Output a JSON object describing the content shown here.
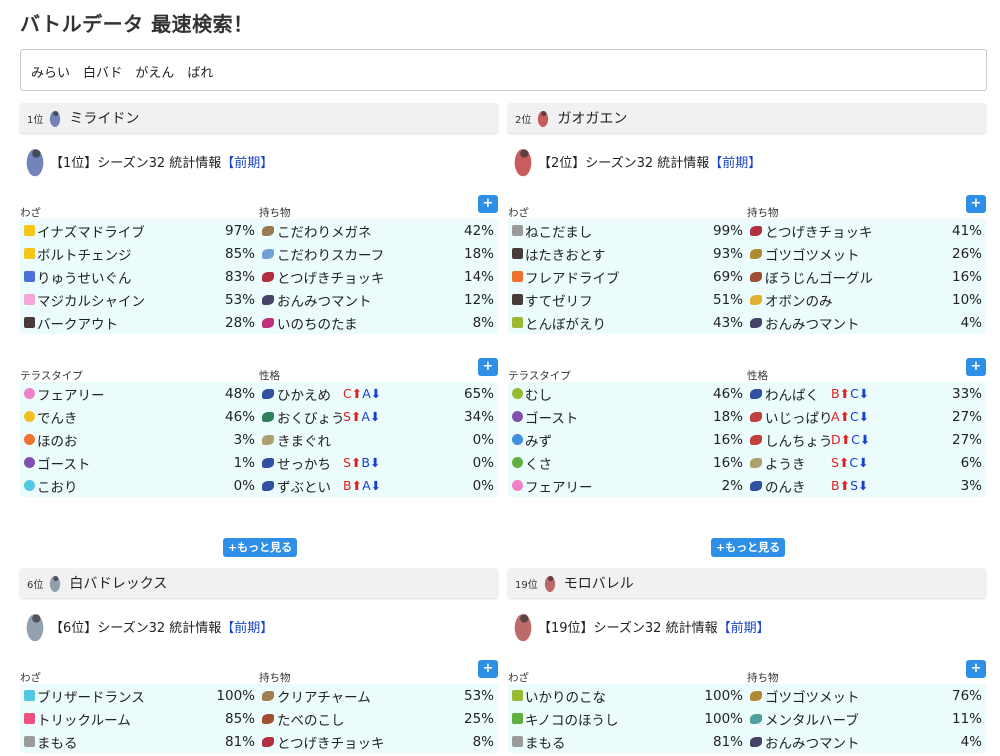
{
  "header": {
    "title": "バトルデータ 最速検索！",
    "search_value": "みらい　白バド　がえん　ばれ"
  },
  "labels": {
    "moves": "わざ",
    "items": "持ち物",
    "tera": "テラスタイプ",
    "nature": "性格",
    "plus": "+",
    "more": "+もっと見る",
    "stat_tag": "【前期】"
  },
  "colors": {
    "accent": "#2e8fe6",
    "row_bg": "#ecfbfb",
    "tag_blue": "#1a44c8",
    "up_red": "#e02020",
    "down_blue": "#1640d0"
  },
  "pokemon": [
    {
      "rank_label": "1位",
      "name": "ミライドン",
      "stat_title": "【1位】シーズン32 統計情報",
      "moves": [
        {
          "name": "イナズマドライブ",
          "pct": "97%",
          "color": "#f5c518"
        },
        {
          "name": "ボルトチェンジ",
          "pct": "85%",
          "color": "#f5c518"
        },
        {
          "name": "りゅうせいぐん",
          "pct": "83%",
          "color": "#4d6fd8"
        },
        {
          "name": "マジカルシャイン",
          "pct": "53%",
          "color": "#f5a6d8"
        },
        {
          "name": "バークアウト",
          "pct": "28%",
          "color": "#4a3b3b"
        }
      ],
      "items": [
        {
          "name": "こだわりメガネ",
          "pct": "42%",
          "color": "#9a7a50"
        },
        {
          "name": "こだわりスカーフ",
          "pct": "18%",
          "color": "#6fa0d8"
        },
        {
          "name": "とつげきチョッキ",
          "pct": "14%",
          "color": "#b03040"
        },
        {
          "name": "おんみつマント",
          "pct": "12%",
          "color": "#444466"
        },
        {
          "name": "いのちのたま",
          "pct": "8%",
          "color": "#c0307a"
        }
      ],
      "tera": [
        {
          "name": "フェアリー",
          "pct": "48%",
          "color": "#f080c8"
        },
        {
          "name": "でんき",
          "pct": "46%",
          "color": "#f0c020"
        },
        {
          "name": "ほのお",
          "pct": "3%",
          "color": "#f07030"
        },
        {
          "name": "ゴースト",
          "pct": "1%",
          "color": "#8050b0"
        },
        {
          "name": "こおり",
          "pct": "0%",
          "color": "#50c8e0"
        }
      ],
      "natures": [
        {
          "name": "ひかえめ",
          "up": "C",
          "down": "A",
          "pct": "65%",
          "color": "#3050a0"
        },
        {
          "name": "おくびょう",
          "up": "S",
          "down": "A",
          "pct": "34%",
          "color": "#308060"
        },
        {
          "name": "きまぐれ",
          "up": "",
          "down": "",
          "pct": "0%",
          "color": "#b0a070"
        },
        {
          "name": "せっかち",
          "up": "S",
          "down": "B",
          "pct": "0%",
          "color": "#3050a0"
        },
        {
          "name": "ずぶとい",
          "up": "B",
          "down": "A",
          "pct": "0%",
          "color": "#3050a0"
        }
      ]
    },
    {
      "rank_label": "2位",
      "name": "ガオガエン",
      "stat_title": "【2位】シーズン32 統計情報",
      "moves": [
        {
          "name": "ねこだまし",
          "pct": "99%",
          "color": "#9a9a9a"
        },
        {
          "name": "はたきおとす",
          "pct": "93%",
          "color": "#4a3b3b"
        },
        {
          "name": "フレアドライブ",
          "pct": "69%",
          "color": "#f07030"
        },
        {
          "name": "すてゼリフ",
          "pct": "51%",
          "color": "#4a3b3b"
        },
        {
          "name": "とんぼがえり",
          "pct": "43%",
          "color": "#9ab830"
        }
      ],
      "items": [
        {
          "name": "とつげきチョッキ",
          "pct": "41%",
          "color": "#b03040"
        },
        {
          "name": "ゴツゴツメット",
          "pct": "26%",
          "color": "#b08a30"
        },
        {
          "name": "ぼうじんゴーグル",
          "pct": "16%",
          "color": "#a05030"
        },
        {
          "name": "オボンのみ",
          "pct": "10%",
          "color": "#e0b030"
        },
        {
          "name": "おんみつマント",
          "pct": "4%",
          "color": "#444466"
        }
      ],
      "tera": [
        {
          "name": "むし",
          "pct": "46%",
          "color": "#9ab830"
        },
        {
          "name": "ゴースト",
          "pct": "18%",
          "color": "#8050b0"
        },
        {
          "name": "みず",
          "pct": "16%",
          "color": "#4090e0"
        },
        {
          "name": "くさ",
          "pct": "16%",
          "color": "#60b040"
        },
        {
          "name": "フェアリー",
          "pct": "2%",
          "color": "#f080c8"
        }
      ],
      "natures": [
        {
          "name": "わんぱく",
          "up": "B",
          "down": "C",
          "pct": "33%",
          "color": "#3050a0"
        },
        {
          "name": "いじっぱり",
          "up": "A",
          "down": "C",
          "pct": "27%",
          "color": "#c04040"
        },
        {
          "name": "しんちょう",
          "up": "D",
          "down": "C",
          "pct": "27%",
          "color": "#c04040"
        },
        {
          "name": "ようき",
          "up": "S",
          "down": "C",
          "pct": "6%",
          "color": "#b0a070"
        },
        {
          "name": "のんき",
          "up": "B",
          "down": "S",
          "pct": "3%",
          "color": "#3050a0"
        }
      ]
    },
    {
      "rank_label": "6位",
      "name": "白バドレックス",
      "stat_title": "【6位】シーズン32 統計情報",
      "moves": [
        {
          "name": "ブリザードランス",
          "pct": "100%",
          "color": "#50c8e0"
        },
        {
          "name": "トリックルーム",
          "pct": "85%",
          "color": "#f05080"
        },
        {
          "name": "まもる",
          "pct": "81%",
          "color": "#9a9a9a"
        }
      ],
      "items": [
        {
          "name": "クリアチャーム",
          "pct": "53%",
          "color": "#a08050"
        },
        {
          "name": "たべのこし",
          "pct": "25%",
          "color": "#a05030"
        },
        {
          "name": "とつげきチョッキ",
          "pct": "8%",
          "color": "#b03040"
        }
      ]
    },
    {
      "rank_label": "19位",
      "name": "モロバレル",
      "stat_title": "【19位】シーズン32 統計情報",
      "moves": [
        {
          "name": "いかりのこな",
          "pct": "100%",
          "color": "#9ab830"
        },
        {
          "name": "キノコのほうし",
          "pct": "100%",
          "color": "#60b040"
        },
        {
          "name": "まもる",
          "pct": "81%",
          "color": "#9a9a9a"
        }
      ],
      "items": [
        {
          "name": "ゴツゴツメット",
          "pct": "76%",
          "color": "#b08a30"
        },
        {
          "name": "メンタルハーブ",
          "pct": "11%",
          "color": "#50a0a0"
        },
        {
          "name": "おんみつマント",
          "pct": "4%",
          "color": "#444466"
        }
      ]
    }
  ]
}
